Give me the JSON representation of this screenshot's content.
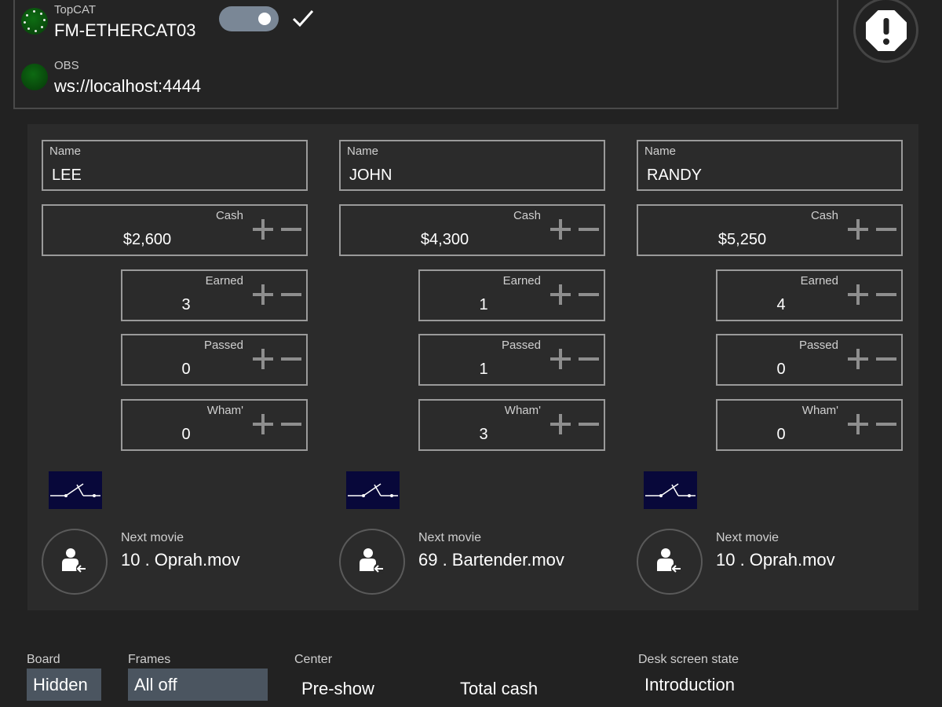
{
  "connections": [
    {
      "label": "TopCAT",
      "value": "FM-ETHERCAT03",
      "status": "connecting",
      "toggle_on": true,
      "confirmed": true
    },
    {
      "label": "OBS",
      "value": "ws://localhost:4444",
      "status": "connected"
    }
  ],
  "players": [
    {
      "name_label": "Name",
      "name": "LEE",
      "cash_label": "Cash",
      "cash": "$2,600",
      "earned_label": "Earned",
      "earned": "3",
      "passed_label": "Passed",
      "passed": "0",
      "wham_label": "Wham'",
      "wham": "0",
      "next_label": "Next movie",
      "next_movie": "10 .  Oprah.mov"
    },
    {
      "name_label": "Name",
      "name": "JOHN",
      "cash_label": "Cash",
      "cash": "$4,300",
      "earned_label": "Earned",
      "earned": "1",
      "passed_label": "Passed",
      "passed": "1",
      "wham_label": "Wham'",
      "wham": "3",
      "next_label": "Next movie",
      "next_movie": "69 .  Bartender.mov"
    },
    {
      "name_label": "Name",
      "name": "RANDY",
      "cash_label": "Cash",
      "cash": "$5,250",
      "earned_label": "Earned",
      "earned": "4",
      "passed_label": "Passed",
      "passed": "0",
      "wham_label": "Wham'",
      "wham": "0",
      "next_label": "Next movie",
      "next_movie": "10 .  Oprah.mov"
    }
  ],
  "bottom": {
    "board_label": "Board",
    "board_value": "Hidden",
    "frames_label": "Frames",
    "frames_value": "All off",
    "center_label": "Center",
    "center_value": "Pre-show",
    "total_cash_label": "Total cash",
    "desk_label": "Desk screen state",
    "desk_value": "Introduction"
  },
  "colors": {
    "background": "#222222",
    "panel": "#2b2b2b",
    "status_green": "#0a5a0f",
    "toggle": "#7a8796",
    "selector": "#4b5560"
  },
  "icons": {
    "status": "status-dot-icon",
    "check": "check-icon",
    "alert": "exclamation-octagon-icon",
    "thumbnail": "switch-diagram-icon",
    "avatar": "user-return-icon",
    "plus": "plus-icon",
    "minus": "minus-icon"
  }
}
